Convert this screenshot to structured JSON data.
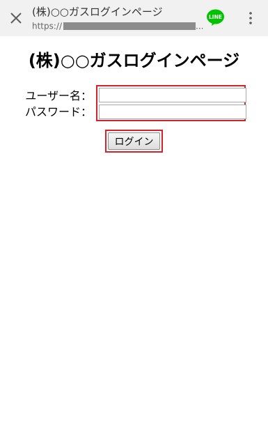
{
  "browser_bar": {
    "title": "(株)○○ガスログインページ",
    "url_prefix": "https://",
    "url_ellipsis": "...",
    "share_icon": "line-app-icon",
    "line_label": "LINE",
    "line_color": "#00c300",
    "close_icon": "close-icon",
    "menu_icon": "more-vert-icon"
  },
  "page": {
    "title": "(株)○○ガスログインページ"
  },
  "form": {
    "username_label": "ユーザー名：",
    "password_label": "パスワード：",
    "username_value": "",
    "password_value": "",
    "login_button": "ログイン",
    "highlight_color": "#d0232a"
  }
}
